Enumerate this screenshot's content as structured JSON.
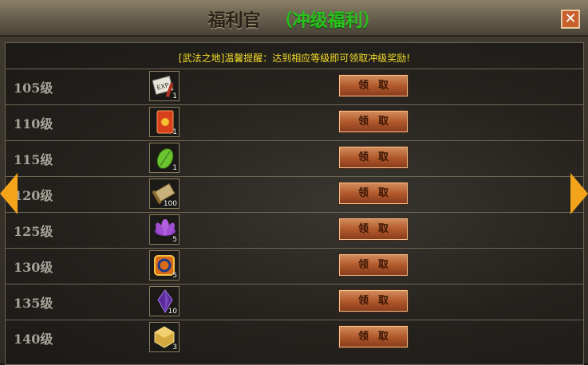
{
  "title": {
    "main": "福利官",
    "sub": "（冲级福利）"
  },
  "close_label": "✕",
  "notice": "[武法之地]温馨提醒：达到相应等级即可领取冲级奖励!",
  "rows": [
    {
      "level": "105级",
      "item_icon": "exp-scroll-icon",
      "count": "1",
      "button": "领取"
    },
    {
      "level": "110级",
      "item_icon": "red-envelope-icon",
      "count": "1",
      "button": "领取"
    },
    {
      "level": "115级",
      "item_icon": "green-leaf-icon",
      "count": "1",
      "button": "领取"
    },
    {
      "level": "120级",
      "item_icon": "scroll-icon",
      "count": "100",
      "button": "领取"
    },
    {
      "level": "125级",
      "item_icon": "purple-lotus-icon",
      "count": "5",
      "button": "领取"
    },
    {
      "level": "130级",
      "item_icon": "orange-rune-icon",
      "count": "5",
      "button": "领取"
    },
    {
      "level": "135级",
      "item_icon": "purple-crystal-icon",
      "count": "10",
      "button": "领取"
    },
    {
      "level": "140级",
      "item_icon": "gold-chest-icon",
      "count": "3",
      "button": "领取"
    }
  ],
  "colors": {
    "accent_green": "#29c21d",
    "notice_yellow": "#f2dd28",
    "button_orange": "#b25a2e",
    "arrow_gold": "#f2a31a"
  }
}
